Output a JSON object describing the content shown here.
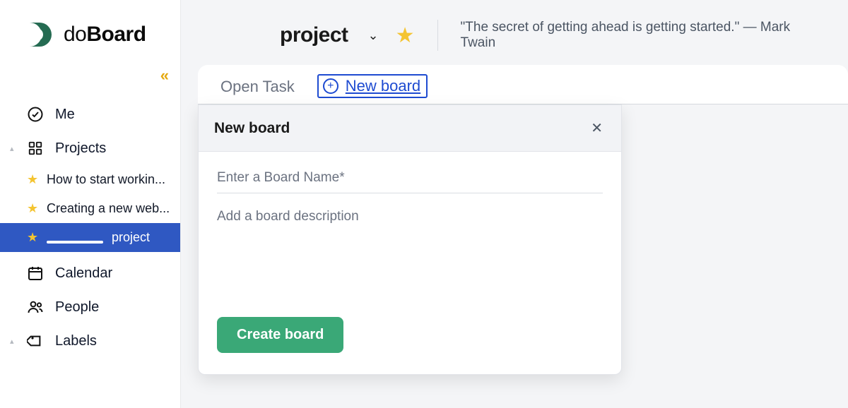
{
  "brand": {
    "prefix": "do",
    "suffix": "Board"
  },
  "sidebar": {
    "collapse_glyph": "«",
    "nav": {
      "me": "Me",
      "projects": "Projects",
      "calendar": "Calendar",
      "people": "People",
      "labels": "Labels"
    },
    "projects": [
      {
        "label": "How to start workin..."
      },
      {
        "label": "Creating a new web..."
      },
      {
        "label": "project",
        "active": true,
        "redacted_prefix": true
      }
    ]
  },
  "header": {
    "project_title": "project",
    "quote": "\"The secret of getting ahead is getting started.\" — Mark Twain"
  },
  "tabs": {
    "open_task": "Open Task",
    "new_board": "New board"
  },
  "modal": {
    "title": "New board",
    "name_placeholder": "Enter a Board Name*",
    "desc_placeholder": "Add a board description",
    "create_label": "Create board"
  }
}
